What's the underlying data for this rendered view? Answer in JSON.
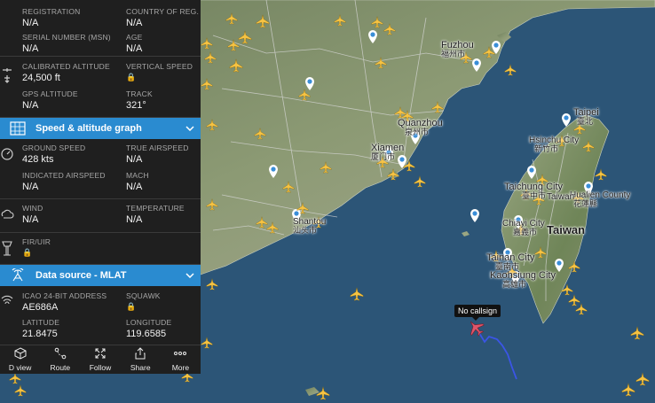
{
  "aircraft_info": {
    "registration_label": "REGISTRATION",
    "registration_value": "N/A",
    "country_label": "COUNTRY OF REG.",
    "country_value": "N/A",
    "serial_label": "SERIAL NUMBER (MSN)",
    "serial_value": "N/A",
    "age_label": "AGE",
    "age_value": "N/A"
  },
  "altitude": {
    "calibrated_label": "CALIBRATED ALTITUDE",
    "calibrated_value": "24,500 ft",
    "vertical_speed_label": "VERTICAL SPEED",
    "gps_label": "GPS ALTITUDE",
    "gps_value": "N/A",
    "track_label": "TRACK",
    "track_value": "321°"
  },
  "speed_graph_header": {
    "title": "Speed & altitude graph"
  },
  "speed": {
    "ground_label": "GROUND SPEED",
    "ground_value": "428 kts",
    "true_label": "TRUE AIRSPEED",
    "true_value": "N/A",
    "indicated_label": "INDICATED AIRSPEED",
    "indicated_value": "N/A",
    "mach_label": "MACH",
    "mach_value": "N/A"
  },
  "weather": {
    "wind_label": "WIND",
    "wind_value": "N/A",
    "temperature_label": "TEMPERATURE",
    "temperature_value": "N/A"
  },
  "fir": {
    "label": "FIR/UIR"
  },
  "data_source_header": {
    "title": "Data source - MLAT"
  },
  "data_source": {
    "icao_label": "ICAO 24-BIT ADDRESS",
    "icao_value": "AE686A",
    "squawk_label": "SQUAWK",
    "latitude_label": "LATITUDE",
    "latitude_value": "21.8475",
    "longitude_label": "LONGITUDE",
    "longitude_value": "119.6585"
  },
  "bottom_bar": [
    {
      "label": "D view",
      "icon": "cube-icon"
    },
    {
      "label": "Route",
      "icon": "route-icon"
    },
    {
      "label": "Follow",
      "icon": "follow-icon"
    },
    {
      "label": "Share",
      "icon": "share-icon"
    },
    {
      "label": "More",
      "icon": "more-icon"
    }
  ],
  "map_labels": {
    "fuzhou_en": "Fuzhou",
    "fuzhou_zh": "福州市",
    "quanzhou_en": "Quanzhou",
    "quanzhou_zh": "泉州市",
    "xiamen_en": "Xiamen",
    "xiamen_zh": "厦门市",
    "shantou_en": "Shantou",
    "shantou_zh": "汕头市",
    "taipei_en": "Taipei",
    "taipei_zh": "臺北",
    "hsinchu_en": "Hsinchu City",
    "hsinchu_zh": "新竹市",
    "taichung_en": "Taichung City",
    "taichung_zh": "臺中市",
    "hualien_en": "Hualien County",
    "hualien_zh": "花蓮縣",
    "taiwan_en": "Taiwan",
    "chiayi_en": "Chiayi City",
    "chiayi_zh": "嘉義市",
    "tainan_en": "Tainan City",
    "tainan_zh": "臺南市",
    "kaohsiung_en": "Kaohsiung City",
    "kaohsiung_zh": "高雄市",
    "taiwan_county": "Taiwan"
  },
  "selected_flight": {
    "callsign": "No callsign"
  },
  "colors": {
    "accent": "#2a8bd0",
    "panel": "#1f1f1f",
    "sea": "#2c5577",
    "land": "#8a9670",
    "plane": "#f6c343",
    "selected_plane": "#e0566a",
    "track": "#3b55e6"
  }
}
